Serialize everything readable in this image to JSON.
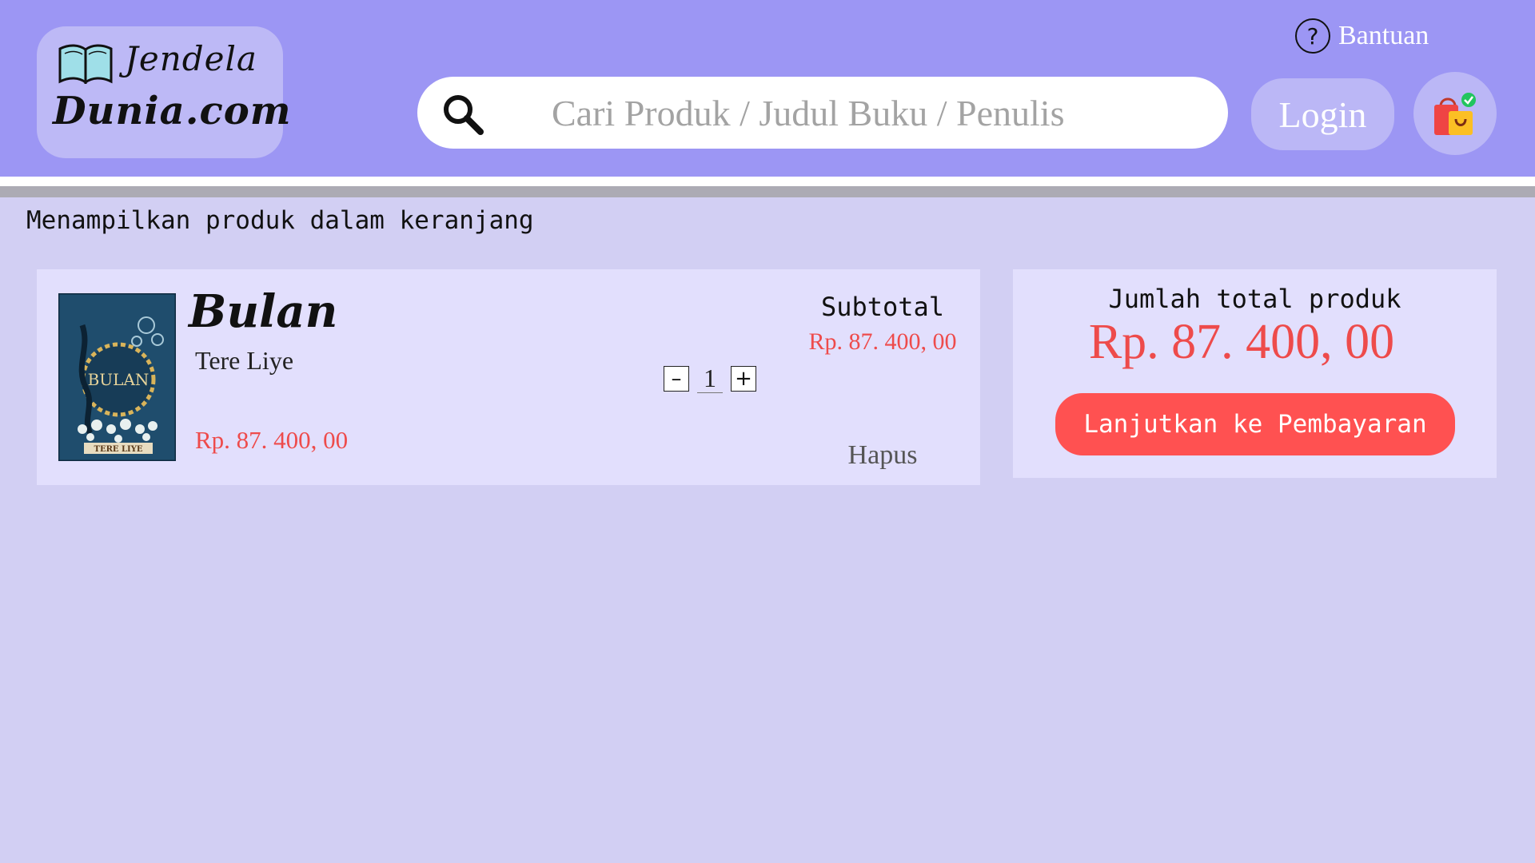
{
  "header": {
    "logo_line1": "Jendela",
    "logo_line2": "Dunia.com",
    "help_label": "Bantuan",
    "search_placeholder": "Cari Produk / Judul Buku / Penulis",
    "login_label": "Login"
  },
  "page_note": "Menampilkan produk dalam keranjang",
  "cart_item": {
    "title": "Bulan",
    "author": "Tere Liye",
    "price": "Rp. 87. 400, 00",
    "quantity": "1",
    "qty_minus": "–",
    "qty_plus": "+",
    "subtotal_label": "Subtotal",
    "subtotal_value": "Rp. 87. 400, 00",
    "remove_label": "Hapus",
    "cover_title": "BULAN",
    "cover_author": "TERE LIYE"
  },
  "summary": {
    "label": "Jumlah total produk",
    "total": "Rp. 87. 400, 00",
    "checkout_label": "Lanjutkan ke Pembayaran"
  },
  "colors": {
    "header_bg": "#9c96f4",
    "page_bg": "#d2cff3",
    "card_bg": "#e2dffd",
    "price_red": "#ee4b4b",
    "checkout_red": "#ff5151"
  },
  "icons": [
    "book-icon",
    "help-icon",
    "search-icon",
    "shopping-bag-icon"
  ]
}
